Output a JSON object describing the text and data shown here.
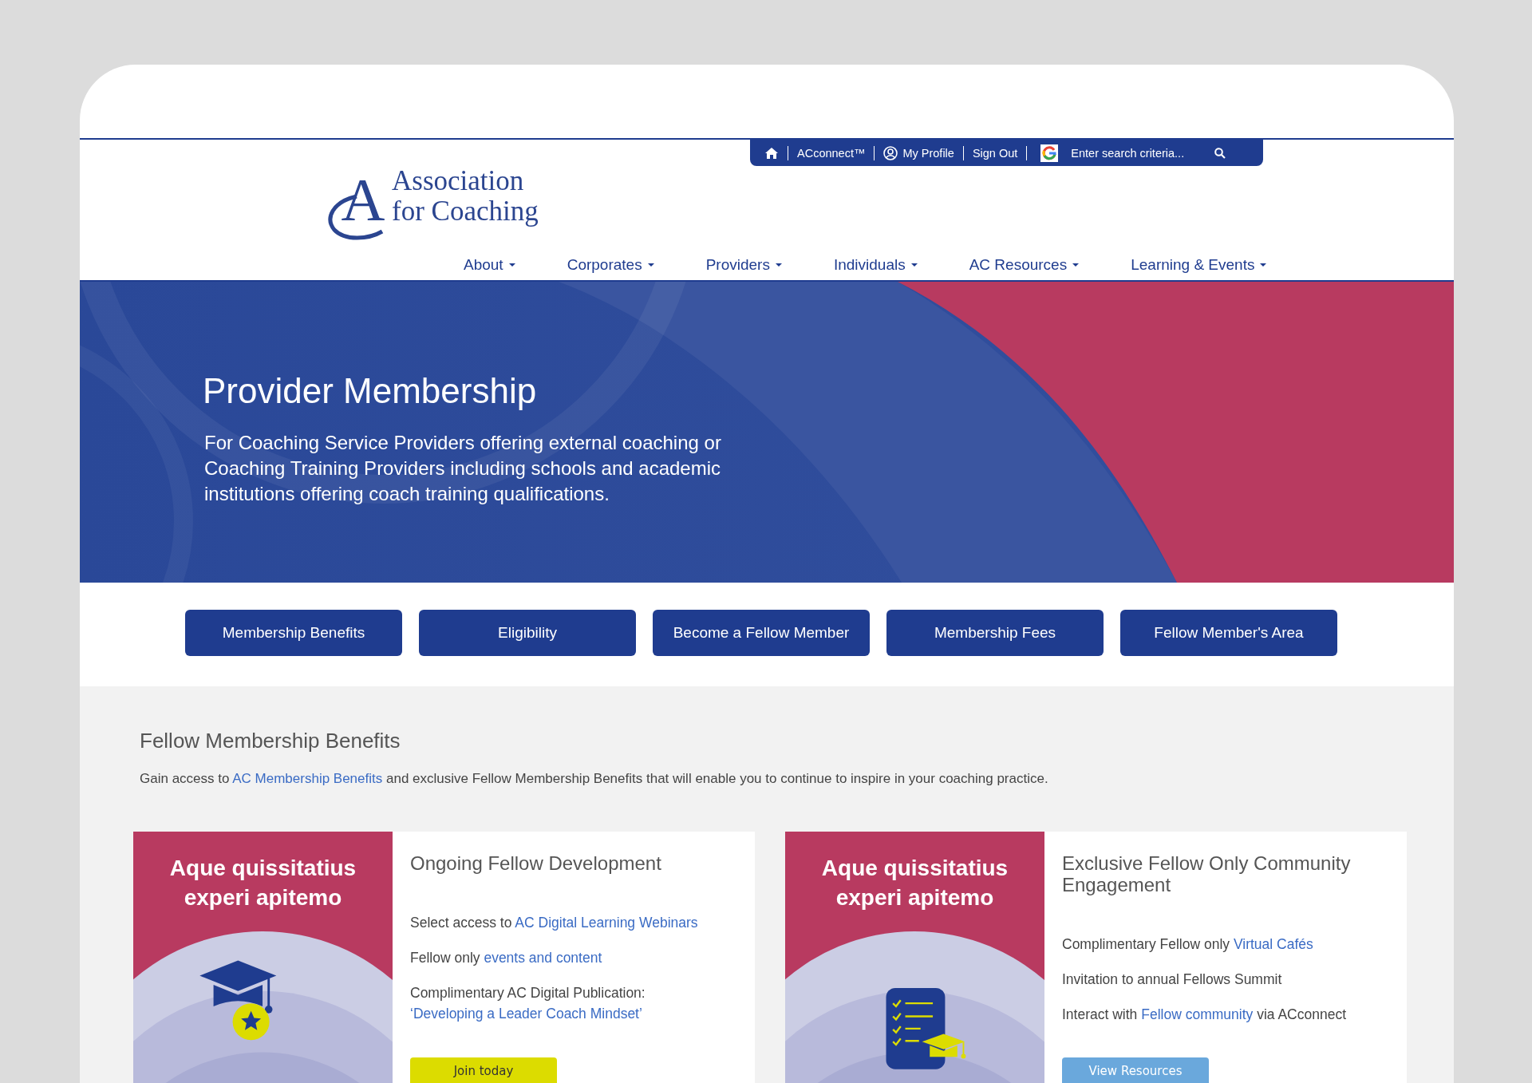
{
  "utility_bar": {
    "items": [
      {
        "kind": "home"
      },
      {
        "kind": "link",
        "label": "ACconnect™"
      },
      {
        "kind": "profile",
        "label": "My Profile"
      },
      {
        "kind": "link",
        "label": "Sign Out"
      },
      {
        "kind": "search",
        "placeholder": "Enter search criteria..."
      }
    ]
  },
  "logo": {
    "mark": "A",
    "lines": [
      "Association",
      "for Coaching"
    ]
  },
  "nav": [
    {
      "label": "About"
    },
    {
      "label": "Corporates"
    },
    {
      "label": "Providers"
    },
    {
      "label": "Individuals"
    },
    {
      "label": "AC Resources"
    },
    {
      "label": "Learning & Events"
    }
  ],
  "hero": {
    "title": "Provider Membership",
    "text": "For Coaching Service Providers offering external coaching or Coaching Training Providers including schools and academic institutions offering coach training qualifications."
  },
  "buttons": [
    "Membership Benefits",
    "Eligibility",
    "Become a Fellow Member",
    "Membership Fees",
    "Fellow Member's Area"
  ],
  "section": {
    "title": "Fellow Membership Benefits",
    "intro": [
      {
        "kind": "text",
        "text": "Gain access to "
      },
      {
        "kind": "link",
        "text": "AC Membership Benefits"
      },
      {
        "kind": "text",
        "text": " and exclusive Fellow Membership Benefits that will enable you to continue to inspire in your coaching practice."
      }
    ]
  },
  "cards": [
    {
      "image_text": "Aque quissitatius experi apitemo",
      "kind": "cap",
      "title": "Ongoing Fellow Development",
      "lines": [
        [
          {
            "kind": "text",
            "text": "Select access to "
          },
          {
            "kind": "link",
            "text": "AC Digital Learning Webinars"
          }
        ],
        [
          {
            "kind": "text",
            "text": "Fellow only "
          },
          {
            "kind": "link",
            "text": "events and content"
          }
        ],
        [
          {
            "kind": "text",
            "text": "Complimentary AC Digital Publication: "
          },
          {
            "kind": "link",
            "text": "‘Developing a Leader Coach Mindset’"
          }
        ]
      ],
      "button": {
        "label": "Join today",
        "kind": "primary"
      }
    },
    {
      "image_text": "Aque quissitatius experi apitemo",
      "kind": "checklist",
      "title": "Exclusive Fellow Only Community Engagement",
      "lines": [
        [
          {
            "kind": "text",
            "text": "Complimentary Fellow only "
          },
          {
            "kind": "link",
            "text": "Virtual Cafés"
          }
        ],
        [
          {
            "kind": "text",
            "text": "Invitation to annual Fellows Summit"
          }
        ],
        [
          {
            "kind": "text",
            "text": "Interact with "
          },
          {
            "kind": "link",
            "text": "Fellow community"
          },
          {
            "kind": "text",
            "text": " via ACconnect"
          }
        ]
      ],
      "button": {
        "label": "View Resources",
        "kind": "secondary"
      }
    }
  ]
}
